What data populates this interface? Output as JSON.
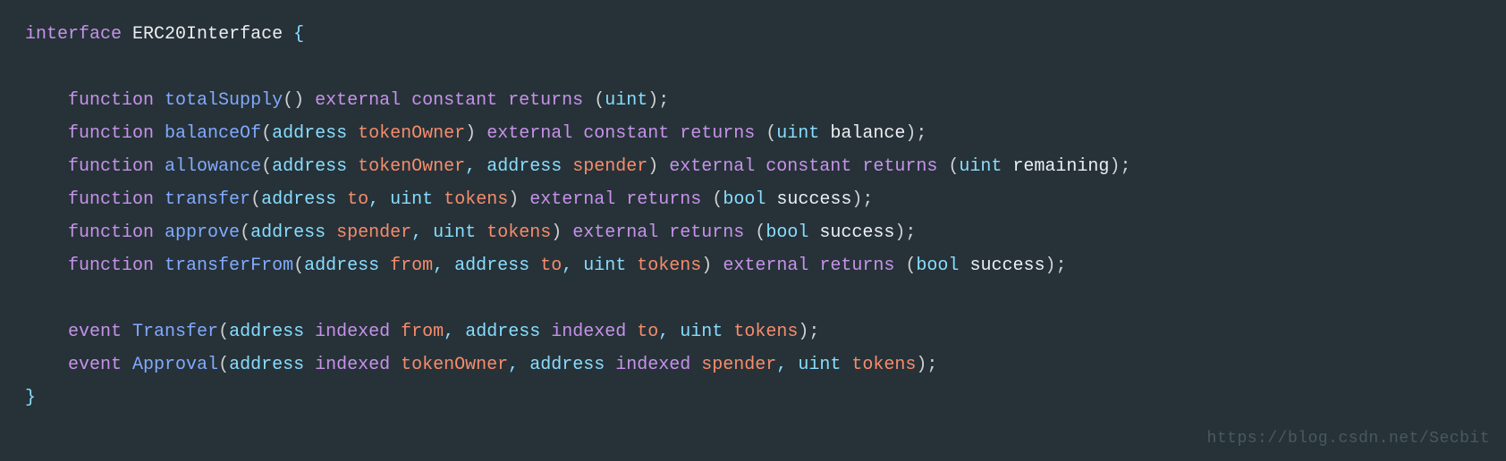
{
  "code": {
    "line1": {
      "kw_interface": "interface",
      "name": "ERC20Interface",
      "brace": "{"
    },
    "functions": [
      {
        "kw": "function",
        "name": "totalSupply",
        "sig_open": "()",
        "mods": [
          "external",
          "constant",
          "returns"
        ],
        "ret_open": "(",
        "ret": [
          {
            "type": "uint",
            "name": ""
          }
        ],
        "ret_close": ");"
      },
      {
        "kw": "function",
        "name": "balanceOf",
        "params": [
          {
            "type": "address",
            "name": "tokenOwner"
          }
        ],
        "mods": [
          "external",
          "constant",
          "returns"
        ],
        "ret": [
          {
            "type": "uint",
            "name": "balance"
          }
        ]
      },
      {
        "kw": "function",
        "name": "allowance",
        "params": [
          {
            "type": "address",
            "name": "tokenOwner"
          },
          {
            "type": "address",
            "name": "spender"
          }
        ],
        "mods": [
          "external",
          "constant",
          "returns"
        ],
        "ret": [
          {
            "type": "uint",
            "name": "remaining"
          }
        ]
      },
      {
        "kw": "function",
        "name": "transfer",
        "params": [
          {
            "type": "address",
            "name": "to"
          },
          {
            "type": "uint",
            "name": "tokens"
          }
        ],
        "mods": [
          "external",
          "returns"
        ],
        "ret": [
          {
            "type": "bool",
            "name": "success"
          }
        ]
      },
      {
        "kw": "function",
        "name": "approve",
        "params": [
          {
            "type": "address",
            "name": "spender"
          },
          {
            "type": "uint",
            "name": "tokens"
          }
        ],
        "mods": [
          "external",
          "returns"
        ],
        "ret": [
          {
            "type": "bool",
            "name": "success"
          }
        ]
      },
      {
        "kw": "function",
        "name": "transferFrom",
        "params": [
          {
            "type": "address",
            "name": "from"
          },
          {
            "type": "address",
            "name": "to"
          },
          {
            "type": "uint",
            "name": "tokens"
          }
        ],
        "mods": [
          "external",
          "returns"
        ],
        "ret": [
          {
            "type": "bool",
            "name": "success"
          }
        ]
      }
    ],
    "events": [
      {
        "kw": "event",
        "name": "Transfer",
        "params": [
          {
            "type": "address",
            "mod": "indexed",
            "name": "from"
          },
          {
            "type": "address",
            "mod": "indexed",
            "name": "to"
          },
          {
            "type": "uint",
            "mod": "",
            "name": "tokens"
          }
        ]
      },
      {
        "kw": "event",
        "name": "Approval",
        "params": [
          {
            "type": "address",
            "mod": "indexed",
            "name": "tokenOwner"
          },
          {
            "type": "address",
            "mod": "indexed",
            "name": "spender"
          },
          {
            "type": "uint",
            "mod": "",
            "name": "tokens"
          }
        ]
      }
    ],
    "close_brace": "}"
  },
  "watermark": "https://blog.csdn.net/Secbit"
}
